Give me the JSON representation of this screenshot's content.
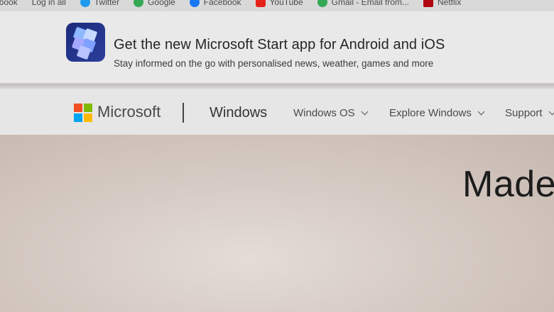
{
  "bookmarks": [
    {
      "label": "Facebook",
      "color": "#1877f2"
    },
    {
      "label": "Log in all",
      "color": "#9a9a9a"
    },
    {
      "label": "Twitter",
      "color": "#1d9bf0"
    },
    {
      "label": "Google",
      "color": "#34a853"
    },
    {
      "label": "Facebook",
      "color": "#1877f2"
    },
    {
      "label": "YouTube",
      "color": "#e62117"
    },
    {
      "label": "Gmail - Email from...",
      "color": "#34a853"
    },
    {
      "label": "Netflix",
      "color": "#b20710"
    }
  ],
  "promo": {
    "title": "Get the new Microsoft Start app for Android and iOS",
    "subtitle": "Stay informed on the go with personalised news, weather, games and more",
    "icon": "microsoft-start-app-icon"
  },
  "header": {
    "brand": "Microsoft",
    "product": "Windows",
    "nav": [
      {
        "label": "Windows OS"
      },
      {
        "label": "Explore Windows"
      },
      {
        "label": "Support"
      }
    ],
    "logo_colors": [
      "#f25022",
      "#7fba00",
      "#00a4ef",
      "#ffb900"
    ]
  },
  "hero": {
    "title": "Made"
  }
}
